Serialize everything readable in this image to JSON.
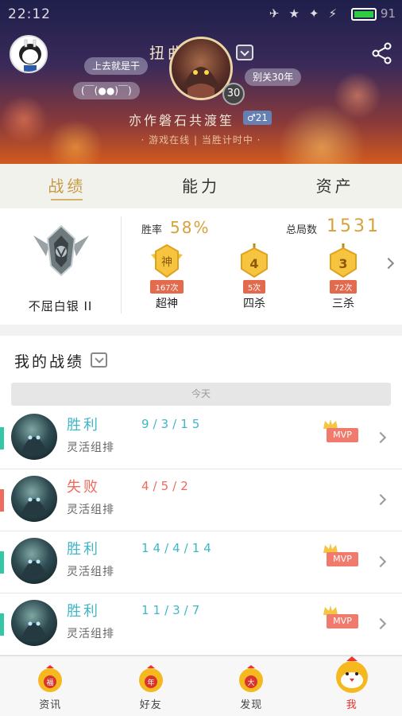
{
  "status_bar": {
    "time": "22:12",
    "battery": "91"
  },
  "profile": {
    "nickname": "扭曲丛林",
    "level": "30",
    "tags": [
      "上去就是干",
      "(￣(●●)￣)",
      "别关30年"
    ],
    "signature": "亦作磐石共渡笙",
    "gender_age": "♂21",
    "online_status": "· 游戏在线 | 当胜计时中 ·"
  },
  "tabs": [
    "战绩",
    "能力",
    "资产"
  ],
  "stats": {
    "rank_name": "不屈白银 II",
    "win_rate_label": "胜率",
    "win_rate": "58%",
    "total_games_label": "总局数",
    "total_games": "1531",
    "badges": [
      {
        "icon_text": "神",
        "count": "167次",
        "name": "超神"
      },
      {
        "icon_text": "4",
        "count": "5次",
        "name": "四杀"
      },
      {
        "icon_text": "3",
        "count": "72次",
        "name": "三杀"
      }
    ]
  },
  "records": {
    "title": "我的战绩",
    "date_group": "今天",
    "matches": [
      {
        "result": "胜利",
        "outcome": "win",
        "mode": "灵活组排",
        "kda": "9/3/15",
        "mvp": "MVP"
      },
      {
        "result": "失败",
        "outcome": "loss",
        "mode": "灵活组排",
        "kda": "4/5/2",
        "mvp": ""
      },
      {
        "result": "胜利",
        "outcome": "win",
        "mode": "灵活组排",
        "kda": "14/4/14",
        "mvp": "MVP"
      },
      {
        "result": "胜利",
        "outcome": "win",
        "mode": "灵活组排",
        "kda": "11/3/7",
        "mvp": "MVP"
      }
    ]
  },
  "bottom_nav": [
    {
      "label": "资讯",
      "icon_text": "福"
    },
    {
      "label": "好友",
      "icon_text": "年"
    },
    {
      "label": "发现",
      "icon_text": "大"
    },
    {
      "label": "我",
      "icon_text": ""
    }
  ],
  "colors": {
    "accent_gold": "#d6a23c",
    "win": "#3fb7c9",
    "loss": "#ef6a5e",
    "mvp": "#f07a6c",
    "nav_active": "#e8302a"
  }
}
